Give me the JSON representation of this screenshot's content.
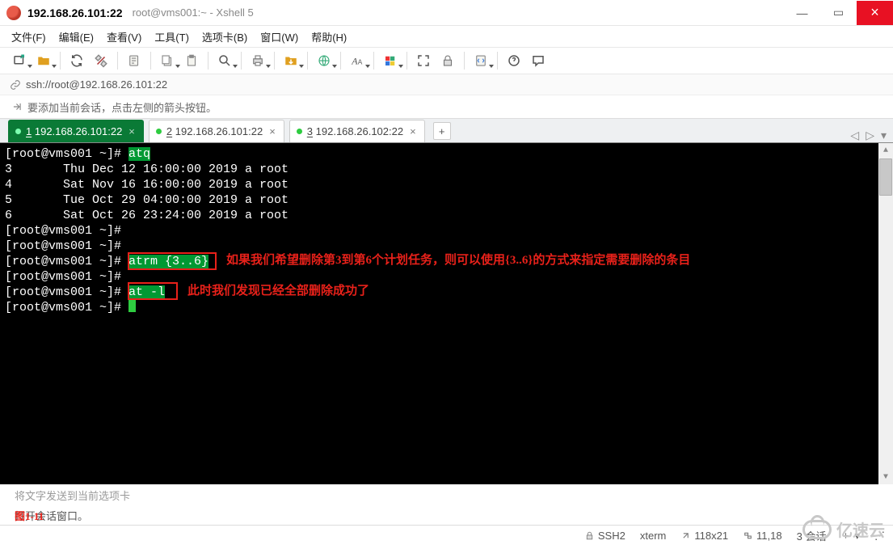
{
  "window": {
    "host": "192.168.26.101:22",
    "subtitle": "root@vms001:~ - Xshell 5"
  },
  "menu": {
    "file": "文件(F)",
    "edit": "编辑(E)",
    "view": "查看(V)",
    "tools": "工具(T)",
    "tab": "选项卡(B)",
    "window": "窗口(W)",
    "help": "帮助(H)"
  },
  "address": "ssh://root@192.168.26.101:22",
  "hint": "要添加当前会话，点击左侧的箭头按钮。",
  "tabs": [
    {
      "num": "1",
      "label": "192.168.26.101:22",
      "active": true
    },
    {
      "num": "2",
      "label": "192.168.26.101:22",
      "active": false
    },
    {
      "num": "3",
      "label": "192.168.26.102:22",
      "active": false
    }
  ],
  "term": {
    "prompt": "[root@vms001 ~]# ",
    "cmd_atq": "atq",
    "rows": [
      "3       Thu Dec 12 16:00:00 2019 a root",
      "4       Sat Nov 16 16:00:00 2019 a root",
      "5       Tue Oct 29 04:00:00 2019 a root",
      "6       Sat Oct 26 23:24:00 2019 a root"
    ],
    "cmd_atrm": "atrm {3..6}",
    "cmd_atl": "at -l"
  },
  "annotation": {
    "line1": "如果我们希望删除第3到第6个计划任务，则可以使用{3..6}的方式来指定需要删除的条目",
    "line2": "此时我们发现已经全部删除成功了",
    "figure": "图1-11"
  },
  "input_send": "将文字发送到当前选项卡",
  "footer_note": "打开会话窗口。",
  "status": {
    "proto": "SSH2",
    "term": "xterm",
    "size": "118x21",
    "pos": "11,18",
    "sess": "3 会话"
  },
  "watermark": "亿速云"
}
